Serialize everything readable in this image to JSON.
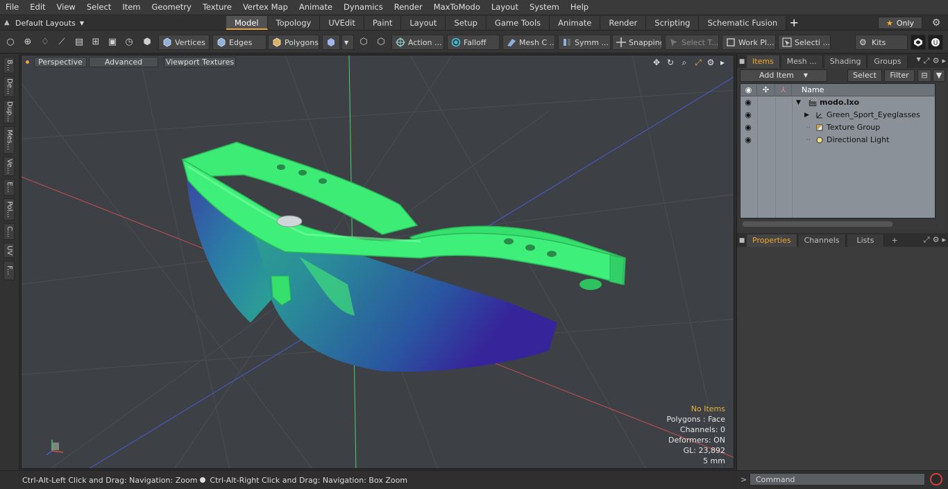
{
  "menubar": {
    "items": [
      "File",
      "Edit",
      "View",
      "Select",
      "Item",
      "Geometry",
      "Texture",
      "Vertex Map",
      "Animate",
      "Dynamics",
      "Render",
      "MaxToModo",
      "Layout",
      "System",
      "Help"
    ]
  },
  "layouts": {
    "label": "Default Layouts",
    "tabs": [
      "Model",
      "Topology",
      "UVEdit",
      "Paint",
      "Layout",
      "Setup",
      "Game Tools",
      "Animate",
      "Render",
      "Scripting",
      "Schematic Fusion"
    ],
    "active_tab": "Model",
    "only_label": "Only"
  },
  "toolbar": {
    "vertices": "Vertices",
    "edges": "Edges",
    "polygons": "Polygons",
    "action": "Action ...",
    "falloff": "Falloff",
    "mesh_c": "Mesh C ...",
    "symm": "Symm ...",
    "snapping": "Snapping",
    "select_t": "Select T...",
    "work_pl": "Work Pl...",
    "selecti": "Selecti ...",
    "kits": "Kits"
  },
  "left_strip": [
    "B...",
    "De...",
    "Dup...",
    "Mes...",
    "Ve...",
    "E...",
    "Pol...",
    "C...",
    "UV",
    "F..."
  ],
  "viewport": {
    "perspective": "Perspective",
    "advanced": "Advanced",
    "viewport_textures": "Viewport Textures",
    "info": {
      "no_items": "No Items",
      "polygons": "Polygons : Face",
      "channels": "Channels: 0",
      "deformers": "Deformers: ON",
      "gl": "GL: 23,892",
      "scale": "5 mm"
    }
  },
  "statusbar": {
    "left": "Ctrl-Alt-Left Click and Drag: Navigation: Zoom",
    "right": "Ctrl-Alt-Right Click and Drag: Navigation: Box Zoom"
  },
  "items_panel": {
    "tabs": [
      "Items",
      "Mesh ...",
      "Shading",
      "Groups"
    ],
    "active_tab": "Items",
    "add_item": "Add Item",
    "select": "Select",
    "filter": "Filter",
    "name_header": "Name",
    "tree": [
      {
        "label": "modo.lxo"
      },
      {
        "label": "Green_Sport_Eyeglasses"
      },
      {
        "label": "Texture Group"
      },
      {
        "label": "Directional Light"
      }
    ]
  },
  "properties_panel": {
    "tabs": [
      "Properties",
      "Channels",
      "Lists"
    ],
    "active_tab": "Properties"
  },
  "command": {
    "placeholder": "Command"
  },
  "colors": {
    "accent": "#e8a53a",
    "frame_green": "#3df07a",
    "lens_teal": "#2a9a8a",
    "lens_blue": "#3a2a9a"
  }
}
